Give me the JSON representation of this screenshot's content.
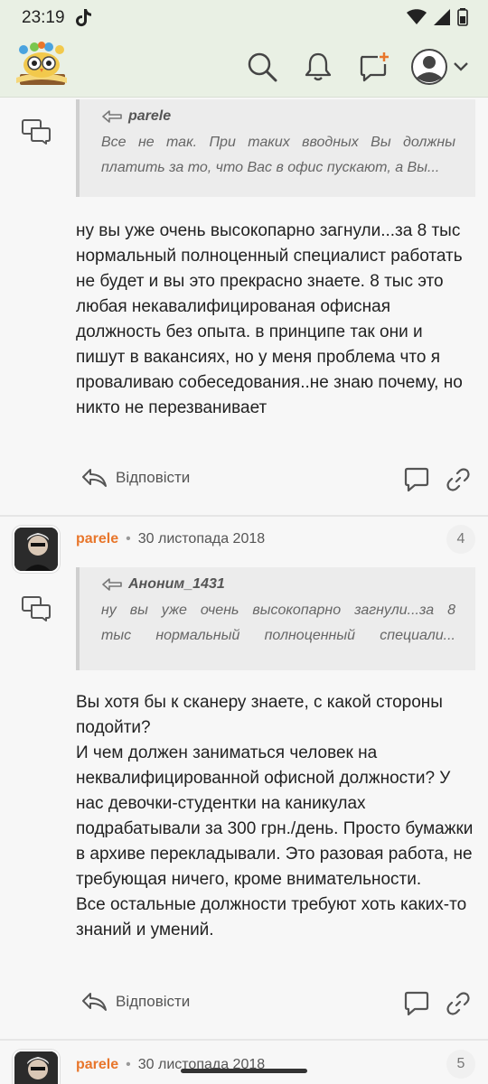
{
  "status_bar": {
    "time": "23:19",
    "icons": [
      "tiktok-icon",
      "wifi-icon",
      "signal-icon",
      "battery-icon"
    ]
  },
  "header": {
    "logo_name": "forum-owl-logo",
    "icons": [
      "search-icon",
      "bell-icon",
      "new-message-icon",
      "avatar-icon",
      "chevron-down-icon"
    ]
  },
  "comments": [
    {
      "quote": {
        "author": "parele",
        "line1": "Все не так. При таких вводных Вы должны",
        "line2": "платить за то, что Вас в офис пускают, а Вы..."
      },
      "body": [
        "ну вы уже очень высокопарно загнули...за 8 тыс нормальный полноценный специалист работать не будет и вы это прекрасно знаете. 8 тыс это любая некавалифицированая офисная должность без опыта. в принципе так они и пишут в вакансиях, но у меня проблема что я проваливаю собеседования..не знаю почему, но никто не перезванивает"
      ],
      "reply_label": "Відповісти"
    },
    {
      "author": "parele",
      "date": "30 листопада 2018",
      "number": "4",
      "quote": {
        "author": "Аноним_1431",
        "line1": "ну вы уже очень высокопарно загнули...за 8",
        "line2": "тыс нормальный полноценный специали..."
      },
      "body": [
        "Вы хотя бы к сканеру знаете, с какой стороны подойти?",
        "И чем должен заниматься человек на неквалифицированной офисной должности? У нас девочки-студентки на каникулах подрабатывали за 300 грн./день. Просто бумажки в архиве перекладывали. Это разовая работа, не требующая ничего, кроме внимательности.",
        "Все остальные должности требуют хоть каких-то знаний и умений."
      ],
      "reply_label": "Відповісти"
    },
    {
      "author": "parele",
      "date": "30 листопада 2018",
      "number": "5"
    }
  ],
  "colors": {
    "header_bg": "#e9f0e4",
    "author": "#e8762b",
    "page_bg": "#f7f7f7"
  }
}
